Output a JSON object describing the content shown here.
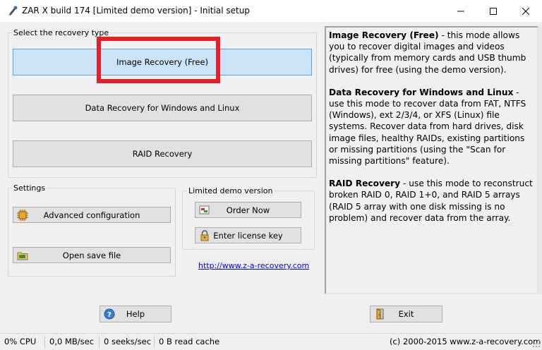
{
  "window": {
    "title": "ZAR X build 174 [Limited demo version] - Initial setup",
    "controls": {
      "minimize": "minimize-icon",
      "maximize": "maximize-icon",
      "close": "close-icon"
    }
  },
  "recovery": {
    "group_label": "Select the recovery type",
    "image_recovery": "Image Recovery (Free)",
    "data_recovery": "Data Recovery for Windows and Linux",
    "raid_recovery": "RAID Recovery"
  },
  "settings": {
    "group_label": "Settings",
    "advanced_config": "Advanced configuration",
    "open_save_file": "Open save file"
  },
  "demo": {
    "group_label": "Limited demo version",
    "order_now": "Order Now",
    "enter_license": "Enter license key",
    "link": "http://www.z-a-recovery.com"
  },
  "info": {
    "p1_title": "Image Recovery (Free)",
    "p1_text": " - this mode allows you to recover digital images and videos (typically from memory cards and USB thumb drives) for free (using the demo version).",
    "p2_title": "Data Recovery for Windows and Linux",
    "p2_text": " - use this mode to recover data from FAT, NTFS (Windows), ext 2/3/4, or XFS (Linux) file systems. Recover data from hard drives, disk image files, healthy RAIDs, existing partitions or missing partitions (using the \"Scan for missing partitions\" feature).",
    "p3_title": "RAID Recovery",
    "p3_text": " - use this mode to reconstruct broken RAID 0, RAID 1+0, and RAID 5 arrays (RAID 5 array with one disk missing is no problem) and recover data from the array."
  },
  "footer": {
    "help": "Help",
    "exit": "Exit"
  },
  "status": {
    "cpu": "0% CPU",
    "rate": "0,0 MB/sec",
    "seeks": "0 seeks/sec",
    "cache": "0 B read cache",
    "copyright": "(c) 2000-2015 www.z-a-recovery.com"
  },
  "colors": {
    "selected_button": "#cce4f7",
    "highlight": "#e4202c",
    "link": "#0000ee"
  }
}
